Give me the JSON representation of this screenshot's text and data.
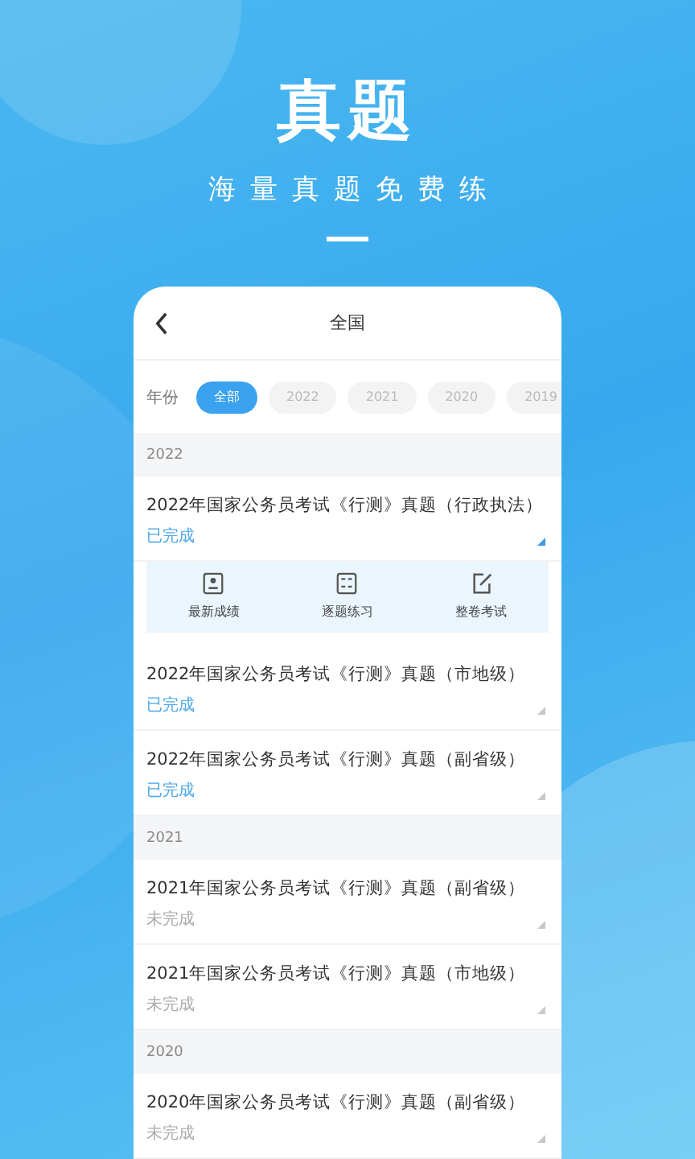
{
  "headline": "真题",
  "subtitle": "海量真题免费练",
  "screen": {
    "title": "全国",
    "filter": {
      "label": "年份",
      "chips": [
        {
          "label": "全部",
          "selected": true
        },
        {
          "label": "2022",
          "selected": false
        },
        {
          "label": "2021",
          "selected": false
        },
        {
          "label": "2020",
          "selected": false
        },
        {
          "label": "2019",
          "selected": false
        }
      ]
    },
    "sections": [
      {
        "year": "2022",
        "items": [
          {
            "title": "2022年国家公务员考试《行测》真题（行政执法）",
            "status": "已完成",
            "done": true,
            "expanded": true,
            "actions": [
              {
                "kind": "score",
                "label": "最新成绩"
              },
              {
                "kind": "practice",
                "label": "逐题练习"
              },
              {
                "kind": "exam",
                "label": "整卷考试"
              }
            ]
          },
          {
            "title": "2022年国家公务员考试《行测》真题（市地级）",
            "status": "已完成",
            "done": true,
            "expanded": false
          },
          {
            "title": "2022年国家公务员考试《行测》真题（副省级）",
            "status": "已完成",
            "done": true,
            "expanded": false
          }
        ]
      },
      {
        "year": "2021",
        "items": [
          {
            "title": "2021年国家公务员考试《行测》真题（副省级）",
            "status": "未完成",
            "done": false,
            "expanded": false
          },
          {
            "title": "2021年国家公务员考试《行测》真题（市地级）",
            "status": "未完成",
            "done": false,
            "expanded": false
          }
        ]
      },
      {
        "year": "2020",
        "items": [
          {
            "title": "2020年国家公务员考试《行测》真题（副省级）",
            "status": "未完成",
            "done": false,
            "expanded": false
          }
        ]
      }
    ]
  }
}
